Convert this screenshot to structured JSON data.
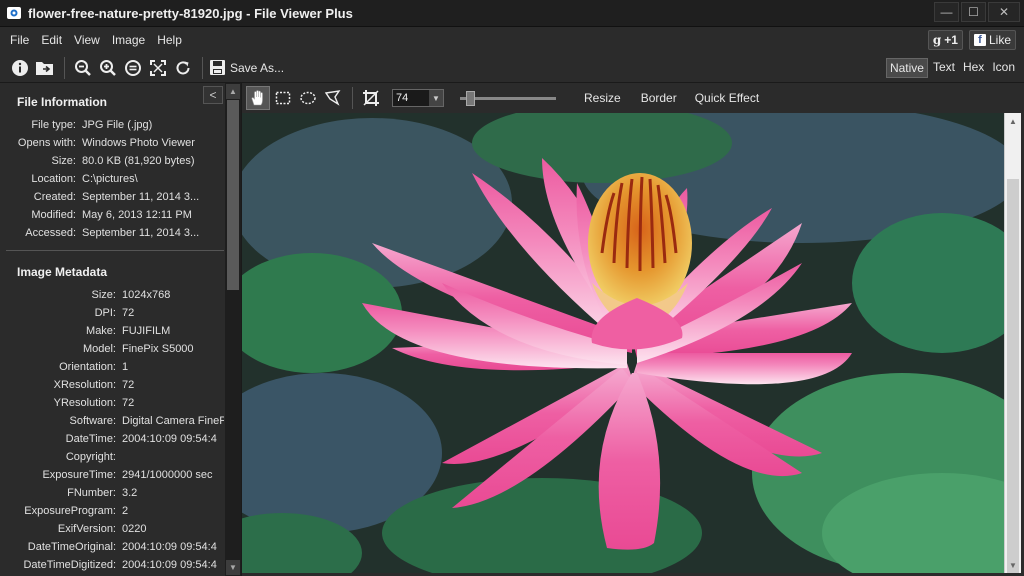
{
  "window": {
    "title": "flower-free-nature-pretty-81920.jpg - File Viewer Plus",
    "minimize": "—",
    "maximize": "☐",
    "close": "✕"
  },
  "menu": [
    "File",
    "Edit",
    "View",
    "Image",
    "Help"
  ],
  "social": {
    "gplus": "+1",
    "like": "Like"
  },
  "toolbar": {
    "save_as": "Save As...",
    "view_modes": [
      "Native",
      "Text",
      "Hex",
      "Icon"
    ],
    "active_mode": "Native"
  },
  "sidebar": {
    "collapse": "<",
    "file_info_title": "File Information",
    "file_info": [
      {
        "k": "File type:",
        "v": "JPG File (.jpg)"
      },
      {
        "k": "Opens with:",
        "v": "Windows Photo Viewer"
      },
      {
        "k": "Size:",
        "v": "80.0 KB (81,920 bytes)"
      },
      {
        "k": "Location:",
        "v": "C:\\pictures\\"
      },
      {
        "k": "Created:",
        "v": "September 11, 2014 3..."
      },
      {
        "k": "Modified:",
        "v": "May 6, 2013 12:11 PM"
      },
      {
        "k": "Accessed:",
        "v": "September 11, 2014 3..."
      }
    ],
    "metadata_title": "Image Metadata",
    "metadata": [
      {
        "k": "Size:",
        "v": "1024x768"
      },
      {
        "k": "DPI:",
        "v": "72"
      },
      {
        "k": "Make:",
        "v": "FUJIFILM"
      },
      {
        "k": "Model:",
        "v": "FinePix S5000"
      },
      {
        "k": "Orientation:",
        "v": "1"
      },
      {
        "k": "XResolution:",
        "v": "72"
      },
      {
        "k": "YResolution:",
        "v": "72"
      },
      {
        "k": "Software:",
        "v": "Digital Camera FineP"
      },
      {
        "k": "DateTime:",
        "v": "2004:10:09 09:54:4"
      },
      {
        "k": "Copyright:",
        "v": ""
      },
      {
        "k": "ExposureTime:",
        "v": "2941/1000000 sec"
      },
      {
        "k": "FNumber:",
        "v": "3.2"
      },
      {
        "k": "ExposureProgram:",
        "v": "2"
      },
      {
        "k": "ExifVersion:",
        "v": "0220"
      },
      {
        "k": "DateTimeOriginal:",
        "v": "2004:10:09 09:54:4"
      },
      {
        "k": "DateTimeDigitized:",
        "v": "2004:10:09 09:54:4"
      }
    ]
  },
  "image_toolbar": {
    "zoom_value": "74",
    "resize": "Resize",
    "border": "Border",
    "quick_effect": "Quick Effect"
  },
  "icons": {
    "toolbar": [
      "info-icon",
      "open-folder-icon",
      "zoom-out-icon",
      "zoom-in-icon",
      "actual-size-icon",
      "fit-screen-icon",
      "rotate-icon",
      "save-icon"
    ],
    "image_tools": [
      "hand-icon",
      "rect-select-icon",
      "ellipse-select-icon",
      "lasso-icon",
      "crop-icon"
    ]
  },
  "colors": {
    "background": "#2b2b2b",
    "petal": "#f06ba8",
    "leaf": "#3f8a5a"
  }
}
